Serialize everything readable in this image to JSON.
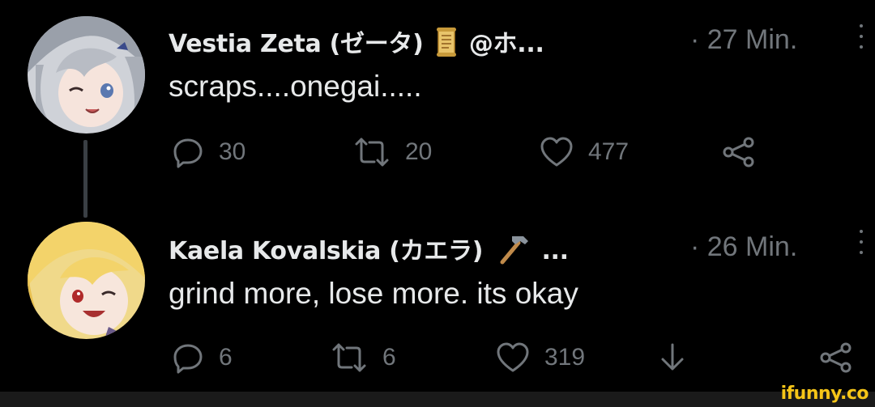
{
  "tweets": [
    {
      "author": "Vestia Zeta (ゼータ)",
      "emoji": "scroll-icon",
      "handle": "@ホ...",
      "time": "· 27 Min.",
      "text": "scraps....onegai.....",
      "replies": "30",
      "retweets": "20",
      "likes": "477"
    },
    {
      "author": "Kaela Kovalskia (カエラ)",
      "emoji": "hammer-icon",
      "handle": "...",
      "time": "· 26 Min.",
      "text": "grind more, lose more. its okay",
      "replies": "6",
      "retweets": "6",
      "likes": "319"
    }
  ],
  "watermark": "ifunny.co",
  "colors": {
    "background": "#000000",
    "text": "#e7e9ea",
    "muted": "#71767b",
    "watermark": "#f5c518"
  }
}
